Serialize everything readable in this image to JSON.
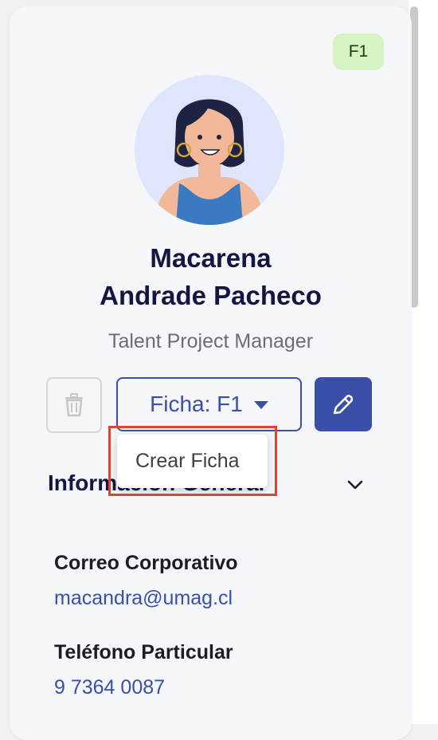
{
  "profile": {
    "badge": "F1",
    "name_line1": "Macarena",
    "name_line2": "Andrade Pacheco",
    "role": "Talent Project Manager"
  },
  "actions": {
    "ficha_label": "Ficha: F1",
    "dropdown_item": "Crear Ficha"
  },
  "section": {
    "title": "Información General"
  },
  "fields": [
    {
      "label": "Correo Corporativo",
      "value": "macandra@umag.cl"
    },
    {
      "label": "Teléfono Particular",
      "value": "9 7364 0087"
    }
  ],
  "icons": {
    "delete": "trash-icon",
    "dropdown": "caret-down-icon",
    "edit": "pencil-icon",
    "collapse": "chevron-down-icon"
  },
  "colors": {
    "accent": "#3a4fa8",
    "badge_bg": "#d6f3c4",
    "highlight": "#e0452c",
    "title": "#14163f"
  }
}
